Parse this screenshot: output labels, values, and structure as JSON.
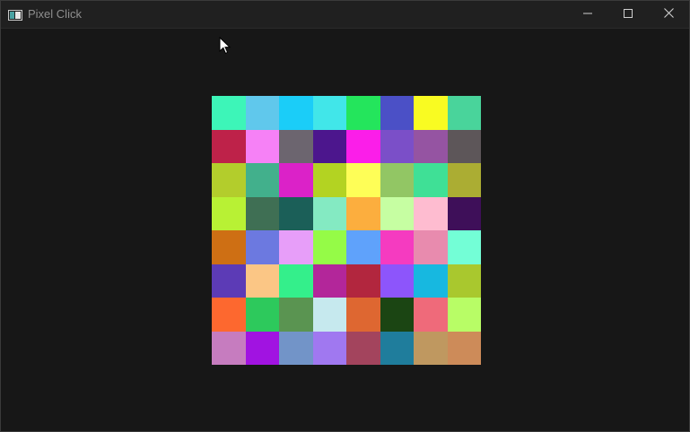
{
  "window": {
    "title": "Pixel Click",
    "icon": "app-window-icon",
    "controls": [
      "minimize-icon",
      "maximize-icon",
      "close-icon"
    ]
  },
  "grid": {
    "rows": 8,
    "cols": 8,
    "colors": [
      [
        "#3df5b8",
        "#60c8ec",
        "#1bcdf8",
        "#41e6e9",
        "#24e55c",
        "#4b50c6",
        "#f9fb22",
        "#49d49b"
      ],
      [
        "#be2249",
        "#f681f6",
        "#6c656f",
        "#4c168d",
        "#fb1ee9",
        "#7b4fc8",
        "#9554a2",
        "#5d5659"
      ],
      [
        "#b3cd2c",
        "#42b08c",
        "#db22c8",
        "#b3d322",
        "#fefe57",
        "#92c664",
        "#3fe096",
        "#abad33"
      ],
      [
        "#b8f134",
        "#3f6f54",
        "#1b5f58",
        "#84eac2",
        "#fcae3e",
        "#c6fea2",
        "#febcd0",
        "#3e0f59"
      ],
      [
        "#ce6f14",
        "#6c79e0",
        "#e79ef9",
        "#95fb47",
        "#5fa2fb",
        "#f53bc0",
        "#e88bae",
        "#73fed6"
      ],
      [
        "#5c3bb6",
        "#fbc685",
        "#34ef8b",
        "#b3269a",
        "#b2263e",
        "#8d55fb",
        "#17b8e0",
        "#a9c82e"
      ],
      [
        "#fd682f",
        "#2dc95c",
        "#5a9451",
        "#c6e9ee",
        "#de6731",
        "#1b4513",
        "#ef6a7a",
        "#b8fd66"
      ],
      [
        "#c67cbf",
        "#a113e1",
        "#7294c8",
        "#a078f0",
        "#a3445d",
        "#1f7d9c",
        "#bf9860",
        "#cd8b59"
      ]
    ]
  }
}
